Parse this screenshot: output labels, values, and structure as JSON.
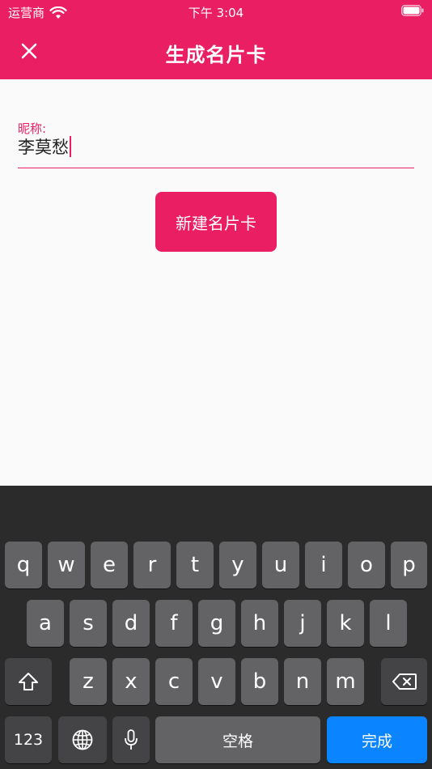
{
  "status_bar": {
    "carrier": "运营商",
    "time": "下午 3:04"
  },
  "app_bar": {
    "title": "生成名片卡",
    "close_icon": "close-icon"
  },
  "form": {
    "nickname_label": "昵称:",
    "nickname_value": "李莫愁",
    "create_button": "新建名片卡"
  },
  "colors": {
    "primary": "#e91e63",
    "keyboard_bg": "#2b2b2b",
    "key": "#636366",
    "key_dark": "#444446",
    "key_action": "#0a84ff"
  },
  "keyboard": {
    "row1": [
      "q",
      "w",
      "e",
      "r",
      "t",
      "y",
      "u",
      "i",
      "o",
      "p"
    ],
    "row2": [
      "a",
      "s",
      "d",
      "f",
      "g",
      "h",
      "j",
      "k",
      "l"
    ],
    "row3": [
      "z",
      "x",
      "c",
      "v",
      "b",
      "n",
      "m"
    ],
    "numbers_key": "123",
    "space_key": "空格",
    "done_key": "完成",
    "shift_icon": "shift-icon",
    "delete_icon": "backspace-icon",
    "globe_icon": "globe-icon",
    "mic_icon": "microphone-icon"
  }
}
